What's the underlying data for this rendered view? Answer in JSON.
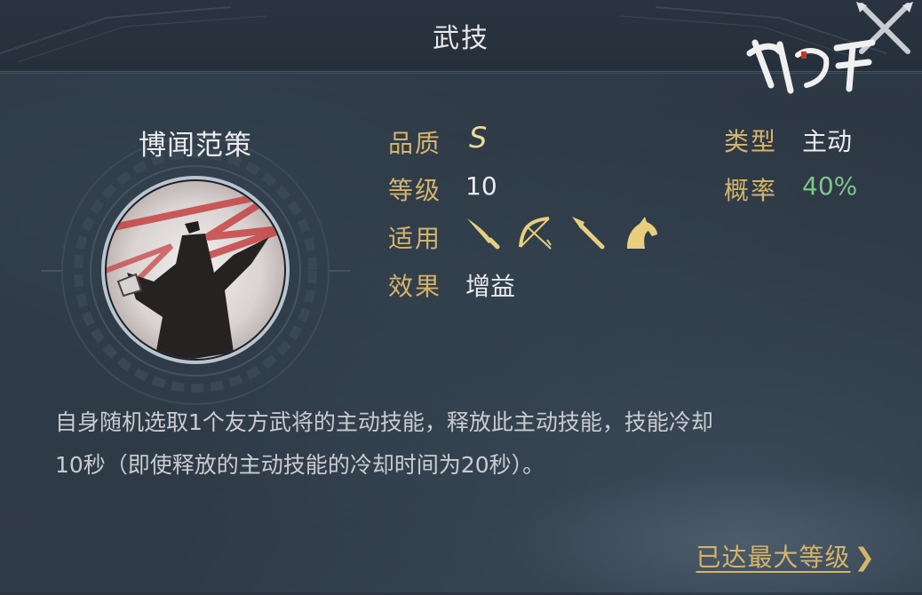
{
  "header": {
    "title": "武技",
    "logo_text": "鸿图之下"
  },
  "skill": {
    "name": "博闻范策",
    "quality_label": "品质",
    "quality_value": "S",
    "level_label": "等级",
    "level_value": "10",
    "applies_label": "适用",
    "applies_icons": [
      "saber-icon",
      "bow-icon",
      "spear-icon",
      "horse-icon"
    ],
    "effect_label": "效果",
    "effect_value": "增益",
    "type_label": "类型",
    "type_value": "主动",
    "rate_label": "概率",
    "rate_value": "40%"
  },
  "description": {
    "line1": "自身随机选取1个友方武将的主动技能，释放此主动技能，技能冷却",
    "line2": "10秒（即使释放的主动技能的冷却时间为20秒）。"
  },
  "footer": {
    "max_level_label": "已达最大等级",
    "chevron": "❯"
  },
  "colors": {
    "label_gold": "#d4b36c",
    "rate_green": "#7fc48a",
    "background": "#2b3641"
  }
}
